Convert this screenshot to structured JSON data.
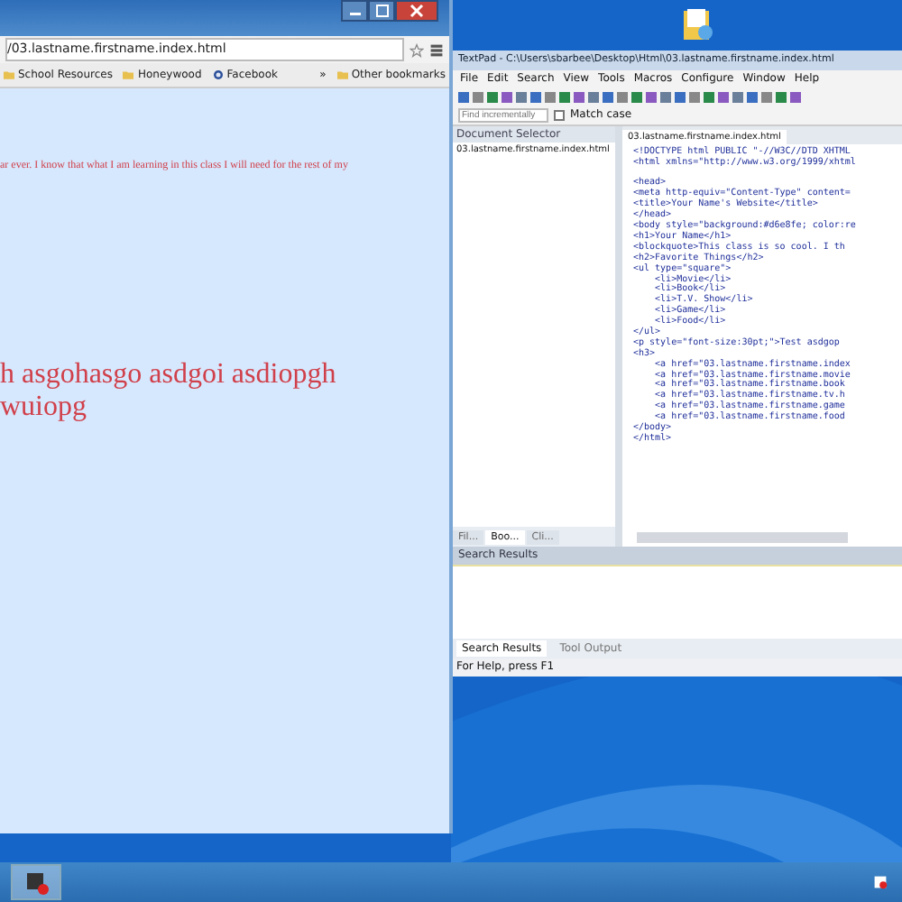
{
  "browser": {
    "address": "/03.lastname.firstname.index.html",
    "bookmarks": [
      {
        "label": "School Resources",
        "kind": "folder"
      },
      {
        "label": "Honeywood",
        "kind": "folder"
      },
      {
        "label": "Facebook",
        "kind": "site"
      }
    ],
    "overflow": "»",
    "other_bookmarks": "Other bookmarks",
    "page": {
      "paragraph": "ar ever. I know that what I am learning in this class I will need for the rest of my",
      "big_text": [
        "h asgohasgo asdgoi asdiopgh",
        "wuiopg"
      ]
    }
  },
  "textpad": {
    "title": "TextPad - C:\\Users\\sbarbee\\Desktop\\Html\\03.lastname.firstname.index.html",
    "menu": [
      "File",
      "Edit",
      "Search",
      "View",
      "Tools",
      "Macros",
      "Configure",
      "Window",
      "Help"
    ],
    "find": {
      "placeholder": "Find incrementally",
      "match_case": "Match case",
      "checked": false
    },
    "document_selector": {
      "title": "Document Selector",
      "items": [
        "03.lastname.firstname.index.html"
      ],
      "tabs": [
        {
          "label": "Fil...",
          "selected": false
        },
        {
          "label": "Boo...",
          "selected": true
        },
        {
          "label": "Cli...",
          "selected": false
        }
      ]
    },
    "editor": {
      "tab": "03.lastname.firstname.index.html",
      "lines": [
        "<!DOCTYPE html PUBLIC \"-//W3C//DTD XHTML",
        "<html xmlns=\"http://www.w3.org/1999/xhtml",
        "<head>",
        "<meta http-equiv=\"Content-Type\" content=",
        "<title>Your Name's Website</title>",
        "</head>",
        "<body style=\"background:#d6e8fe; color:re",
        "<h1>Your Name</h1>",
        "<blockquote>This class is so cool. I th",
        "<h2>Favorite Things</h2>",
        "<ul type=\"square\">",
        "    <li>Movie</li>",
        "    <li>Book</li>",
        "    <li>T.V. Show</li>",
        "    <li>Game</li>",
        "    <li>Food</li>",
        "</ul>",
        "<p style=\"font-size:30pt;\">Test asdgop",
        "<h3>",
        "    <a href=\"03.lastname.firstname.index",
        "    <a href=\"03.lastname.firstname.movie",
        "    <a href=\"03.lastname.firstname.book",
        "    <a href=\"03.lastname.firstname.tv.h",
        "    <a href=\"03.lastname.firstname.game",
        "    <a href=\"03.lastname.firstname.food",
        "</body>",
        "</html>"
      ]
    },
    "search_results": {
      "title": "Search Results",
      "tabs": [
        {
          "label": "Search Results",
          "selected": true
        },
        {
          "label": "Tool Output",
          "selected": false
        }
      ]
    },
    "status": "For Help, press F1"
  }
}
